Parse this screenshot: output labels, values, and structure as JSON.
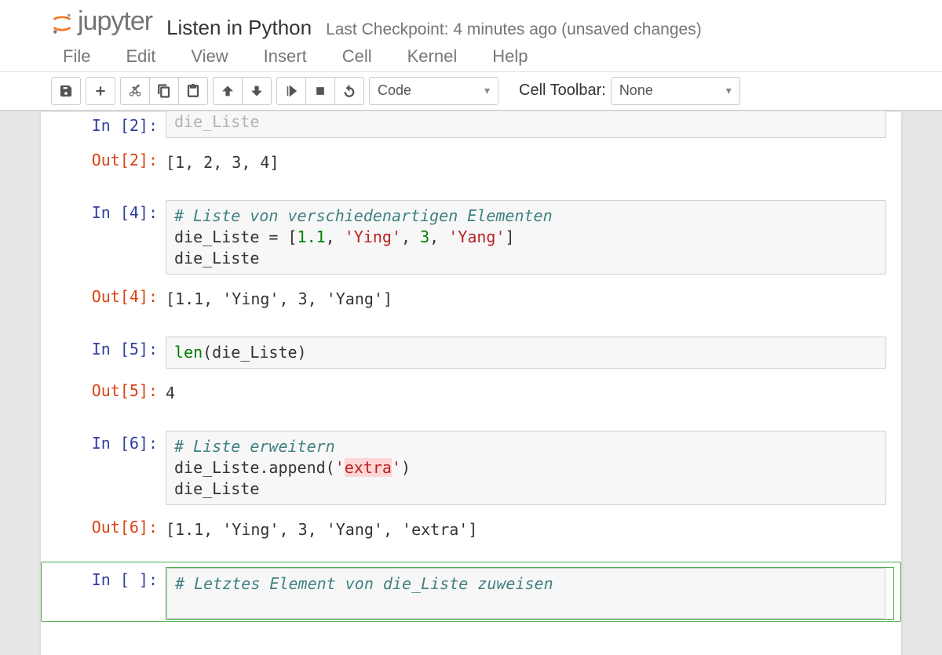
{
  "header": {
    "logo_text": "jupyter",
    "title": "Listen in Python",
    "checkpoint": "Last Checkpoint: 4 minutes ago (unsaved changes)"
  },
  "menu": {
    "file": "File",
    "edit": "Edit",
    "view": "View",
    "insert": "Insert",
    "cell": "Cell",
    "kernel": "Kernel",
    "help": "Help"
  },
  "toolbar": {
    "cell_type": "Code",
    "cell_toolbar_label": "Cell Toolbar:",
    "cell_toolbar_value": "None"
  },
  "cells": {
    "c0": {
      "in_prompt": "In [2]:",
      "in_code_plain": "die_Liste",
      "out_prompt": "Out[2]:",
      "out_text": "[1, 2, 3, 4]"
    },
    "c1": {
      "in_prompt": "In [4]:",
      "comment": "# Liste von verschiedenartigen Elementen",
      "line2_pre": "die_Liste = [",
      "num1": "1.1",
      "str1": "'Ying'",
      "num2": "3",
      "str2": "'Yang'",
      "line2_post": "]",
      "line3": "die_Liste",
      "out_prompt": "Out[4]:",
      "out_text": "[1.1, 'Ying', 3, 'Yang']"
    },
    "c2": {
      "in_prompt": "In [5]:",
      "builtin": "len",
      "rest": "(die_Liste)",
      "out_prompt": "Out[5]:",
      "out_text": "4"
    },
    "c3": {
      "in_prompt": "In [6]:",
      "comment": "# Liste erweitern",
      "line2_pre": "die_Liste.append(",
      "str_q1": "'",
      "str_hl": "extra",
      "str_q2": "'",
      "line2_post": ")",
      "line3": "die_Liste",
      "out_prompt": "Out[6]:",
      "out_text": "[1.1, 'Ying', 3, 'Yang', 'extra']"
    },
    "c4": {
      "in_prompt": "In [ ]:",
      "comment": "# Letztes Element von die_Liste zuweisen"
    }
  }
}
